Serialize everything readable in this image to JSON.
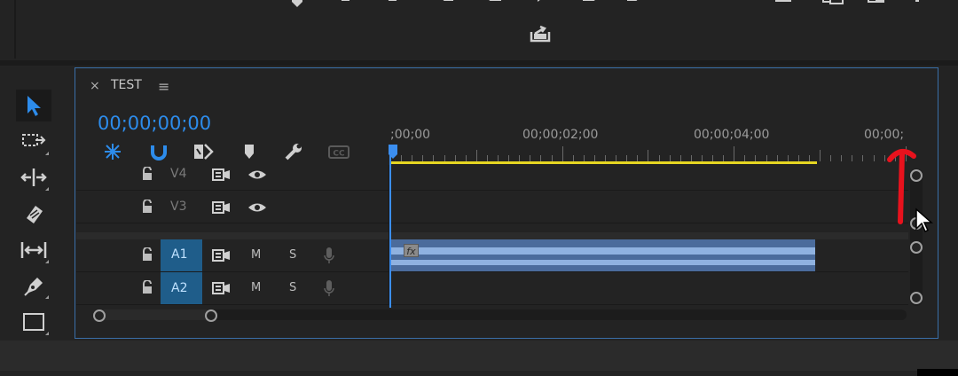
{
  "sequence": {
    "close_glyph": "×",
    "name": "TEST",
    "menu_glyph": "≡",
    "timecode": "00;00;00;00"
  },
  "ruler": {
    "labels": [
      ";00;00",
      "00;00;02;00",
      "00;00;04;00",
      "00;00;"
    ]
  },
  "tracks": {
    "video": [
      {
        "name": "V4"
      },
      {
        "name": "V3"
      }
    ],
    "audio": [
      {
        "name": "A1",
        "mute": "M",
        "solo": "S"
      },
      {
        "name": "A2",
        "mute": "M",
        "solo": "S"
      }
    ]
  },
  "clip": {
    "fx_label": "fx"
  },
  "toolbar_top_icons": [
    "add-marker-icon",
    "mark-in-icon",
    "mark-out-icon",
    "go-to-in-icon",
    "step-back-icon",
    "play-icon",
    "step-forward-icon",
    "go-to-out-icon",
    "lift-icon",
    "extract-icon",
    "export-frame-icon",
    "comparison-icon",
    "trim-icon",
    "more-icon",
    "share-icon"
  ],
  "tools": [
    "selection-tool",
    "track-select-tool",
    "ripple-edit-tool",
    "razor-tool",
    "slip-tool",
    "pen-tool",
    "rectangle-tool"
  ],
  "timeline_tools": [
    "nest-toggle",
    "snap-toggle",
    "linked-selection",
    "add-marker",
    "timeline-settings",
    "captions"
  ],
  "colors": {
    "accent": "#2d8ceb",
    "work_area": "#e6d622",
    "clip": "#4b6c9c",
    "annotation": "#e8121d"
  }
}
